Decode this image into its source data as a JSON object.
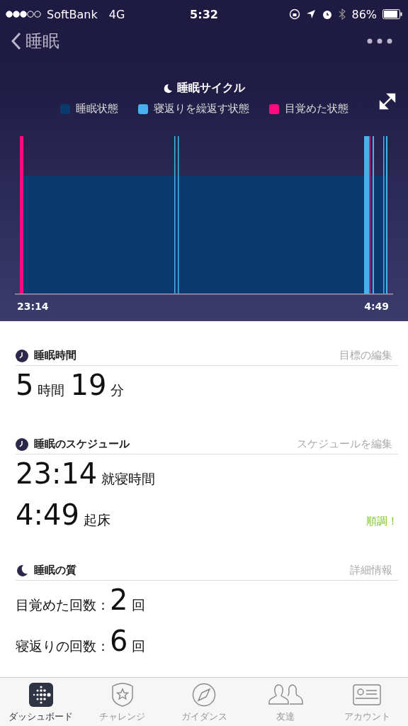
{
  "status_bar": {
    "carrier": "SoftBank",
    "network": "4G",
    "time": "5:32",
    "battery": "86%"
  },
  "nav": {
    "back_label": "睡眠"
  },
  "chart": {
    "title": "睡眠サイクル",
    "legend": [
      {
        "label": "睡眠状態",
        "color": "#0b3a6e"
      },
      {
        "label": "寝返りを繰返す状態",
        "color": "#45b1ee"
      },
      {
        "label": "目覚めた状態",
        "color": "#ff0a7e"
      }
    ],
    "start_label": "23:14",
    "end_label": "4:49"
  },
  "sections": [
    {
      "title": "睡眠時間",
      "action": "目標の編集",
      "rows": [
        {
          "parts": [
            {
              "kind": "big",
              "text": "5"
            },
            {
              "kind": "unit",
              "text": "時間"
            },
            {
              "kind": "big",
              "text": "19"
            },
            {
              "kind": "unit",
              "text": "分"
            }
          ]
        }
      ]
    },
    {
      "title": "睡眠のスケジュール",
      "action": "スケジュールを編集",
      "rows": [
        {
          "parts": [
            {
              "kind": "big",
              "text": "23:14"
            },
            {
              "kind": "unit",
              "text": "就寝時間"
            }
          ]
        },
        {
          "parts": [
            {
              "kind": "big",
              "text": "4:49"
            },
            {
              "kind": "unit",
              "text": "起床"
            }
          ],
          "note": "順調！"
        }
      ]
    },
    {
      "title": "睡眠の質",
      "action": "詳細情報",
      "rows": [
        {
          "parts": [
            {
              "kind": "label",
              "text": "目覚めた回数："
            },
            {
              "kind": "big",
              "text": "2"
            },
            {
              "kind": "unit",
              "text": "回"
            }
          ]
        },
        {
          "parts": [
            {
              "kind": "label",
              "text": "寝返りの回数："
            },
            {
              "kind": "big",
              "text": "6"
            },
            {
              "kind": "unit",
              "text": "回"
            }
          ]
        }
      ]
    }
  ],
  "tabs": [
    {
      "label": "ダッシュボード",
      "selected": true
    },
    {
      "label": "チャレンジ",
      "selected": false
    },
    {
      "label": "ガイダンス",
      "selected": false
    },
    {
      "label": "友達",
      "selected": false
    },
    {
      "label": "アカウント",
      "selected": false
    }
  ]
}
